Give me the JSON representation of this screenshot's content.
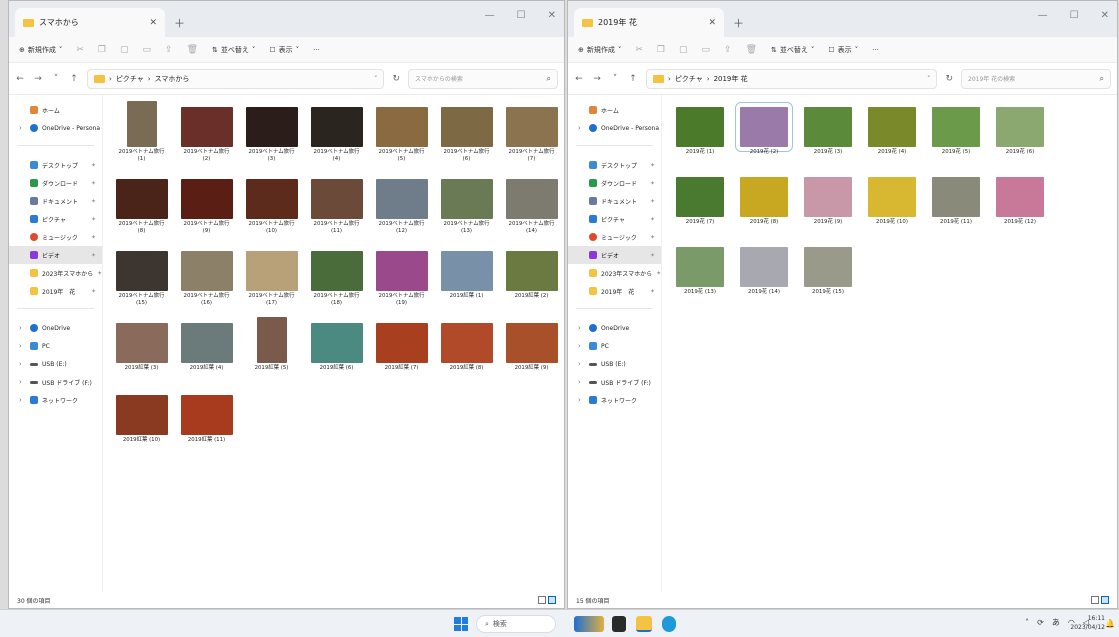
{
  "left": {
    "tab_title": "スマホから",
    "toolbar": {
      "new": "新規作成",
      "sort": "並べ替え",
      "view": "表示",
      "more": "···"
    },
    "address": [
      "ピクチャ",
      "スマホから"
    ],
    "search_placeholder": "スマホからの検索",
    "status": "30 個の項目",
    "items": [
      {
        "line1": "2019ベトナム旅行",
        "line2": "(1)",
        "color": "#7a6b55",
        "tall": true
      },
      {
        "line1": "2019ベトナム旅行",
        "line2": "(2)",
        "color": "#6b2f2a"
      },
      {
        "line1": "2019ベトナム旅行",
        "line2": "(3)",
        "color": "#2a1d1a"
      },
      {
        "line1": "2019ベトナム旅行",
        "line2": "(4)",
        "color": "#2b2520"
      },
      {
        "line1": "2019ベトナム旅行",
        "line2": "(5)",
        "color": "#8a6a40"
      },
      {
        "line1": "2019ベトナム旅行",
        "line2": "(6)",
        "color": "#7d6a45"
      },
      {
        "line1": "2019ベトナム旅行",
        "line2": "(7)",
        "color": "#8b7350"
      },
      {
        "line1": "2019ベトナム旅行",
        "line2": "(8)",
        "color": "#4a2418"
      },
      {
        "line1": "2019ベトナム旅行",
        "line2": "(9)",
        "color": "#5a1e14"
      },
      {
        "line1": "2019ベトナム旅行",
        "line2": "(10)",
        "color": "#5c2b1c"
      },
      {
        "line1": "2019ベトナム旅行",
        "line2": "(11)",
        "color": "#6b4a3a"
      },
      {
        "line1": "2019ベトナム旅行",
        "line2": "(12)",
        "color": "#6f7d8a"
      },
      {
        "line1": "2019ベトナム旅行",
        "line2": "(13)",
        "color": "#6a7a55"
      },
      {
        "line1": "2019ベトナム旅行",
        "line2": "(14)",
        "color": "#7d7a70"
      },
      {
        "line1": "2019ベトナム旅行",
        "line2": "(15)",
        "color": "#3d3630"
      },
      {
        "line1": "2019ベトナム旅行",
        "line2": "(16)",
        "color": "#8c8068"
      },
      {
        "line1": "2019ベトナム旅行",
        "line2": "(17)",
        "color": "#b8a078"
      },
      {
        "line1": "2019ベトナム旅行",
        "line2": "(18)",
        "color": "#4a6b3a"
      },
      {
        "line1": "2019ベトナム旅行",
        "line2": "(19)",
        "color": "#9a4a8a"
      },
      {
        "line1": "2019紅葉 (1)",
        "line2": "",
        "color": "#7890a8"
      },
      {
        "line1": "2019紅葉 (2)",
        "line2": "",
        "color": "#6a7a40"
      },
      {
        "line1": "2019紅葉 (3)",
        "line2": "",
        "color": "#8a6a5a"
      },
      {
        "line1": "2019紅葉 (4)",
        "line2": "",
        "color": "#6b7a7a"
      },
      {
        "line1": "2019紅葉 (5)",
        "line2": "",
        "color": "#7a5a4a",
        "tall": true
      },
      {
        "line1": "2019紅葉 (6)",
        "line2": "",
        "color": "#4a8a80"
      },
      {
        "line1": "2019紅葉 (7)",
        "line2": "",
        "color": "#a84020"
      },
      {
        "line1": "2019紅葉 (8)",
        "line2": "",
        "color": "#b04a28"
      },
      {
        "line1": "2019紅葉 (9)",
        "line2": "",
        "color": "#a8502a"
      },
      {
        "line1": "2019紅葉 (10)",
        "line2": "",
        "color": "#8a3a20"
      },
      {
        "line1": "2019紅葉 (11)",
        "line2": "",
        "color": "#a83a1e"
      }
    ]
  },
  "right": {
    "tab_title": "2019年 花",
    "toolbar": {
      "new": "新規作成",
      "sort": "並べ替え",
      "view": "表示",
      "more": "···"
    },
    "address": [
      "ピクチャ",
      "2019年 花"
    ],
    "search_placeholder": "2019年 花の検索",
    "status": "15 個の項目",
    "items": [
      {
        "line1": "2019花 (1)",
        "line2": "",
        "color": "#4a7a2a"
      },
      {
        "line1": "2019花 (2)",
        "line2": "",
        "color": "#9a7aa8",
        "selected": true
      },
      {
        "line1": "2019花 (3)",
        "line2": "",
        "color": "#5a8a3a"
      },
      {
        "line1": "2019花 (4)",
        "line2": "",
        "color": "#7a8a2a"
      },
      {
        "line1": "2019花 (5)",
        "line2": "",
        "color": "#6a9a4a"
      },
      {
        "line1": "2019花 (6)",
        "line2": "",
        "color": "#8aa870"
      },
      {
        "line1": "2019花 (7)",
        "line2": "",
        "color": "#4a7a30"
      },
      {
        "line1": "2019花 (8)",
        "line2": "",
        "color": "#c8a820"
      },
      {
        "line1": "2019花 (9)",
        "line2": "",
        "color": "#c898a8"
      },
      {
        "line1": "2019花 (10)",
        "line2": "",
        "color": "#d8b830"
      },
      {
        "line1": "2019花 (11)",
        "line2": "",
        "color": "#8a8a7a"
      },
      {
        "line1": "2019花 (12)",
        "line2": "",
        "color": "#c87898"
      },
      {
        "line1": "2019花 (13)",
        "line2": "",
        "color": "#7a9a6a"
      },
      {
        "line1": "2019花 (14)",
        "line2": "",
        "color": "#a8a8b0"
      },
      {
        "line1": "2019花 (15)",
        "line2": "",
        "color": "#9a9a8a"
      }
    ]
  },
  "sidebar": {
    "home": "ホーム",
    "onedrive_personal": "OneDrive - Persona",
    "quick": [
      {
        "label": "デスクトップ",
        "color": "#3a8ad8"
      },
      {
        "label": "ダウンロード",
        "color": "#2a9a4a"
      },
      {
        "label": "ドキュメント",
        "color": "#6a7a9a"
      },
      {
        "label": "ピクチャ",
        "color": "#2a7ad8"
      },
      {
        "label": "ミュージック",
        "color": "#e04a2a"
      },
      {
        "label": "ビデオ",
        "color": "#8a3ad8"
      },
      {
        "label": "2023年スマホから",
        "color": "#f5c342"
      },
      {
        "label": "2019年　花",
        "color": "#f5c342"
      }
    ],
    "locations": [
      {
        "label": "OneDrive",
        "color": "#1f6fd0"
      },
      {
        "label": "PC",
        "color": "#3a8ad8"
      },
      {
        "label": "USB (E:)",
        "color": "#555555"
      },
      {
        "label": "USB ドライブ (F:)",
        "color": "#555555"
      },
      {
        "label": "ネットワーク",
        "color": "#2a7ad8"
      }
    ]
  },
  "taskbar": {
    "search": "検索",
    "time": "16:11",
    "date": "2023/04/12",
    "ime": "あ"
  }
}
